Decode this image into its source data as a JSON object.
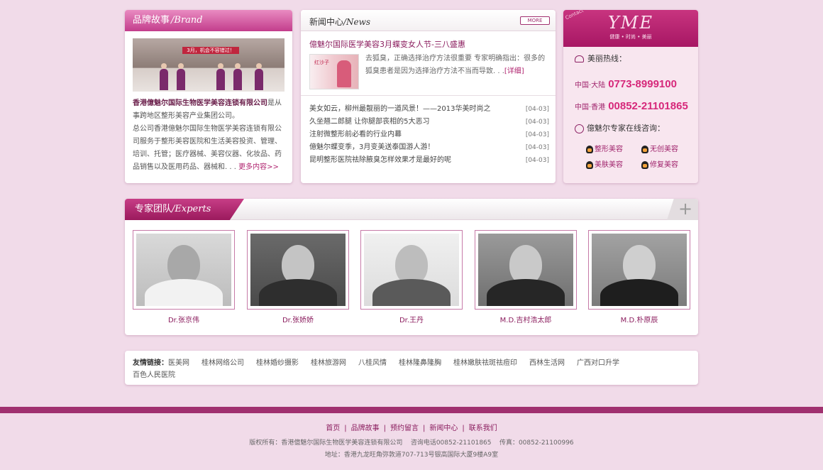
{
  "brand": {
    "title_cn": "品牌故事",
    "title_en": "/Brand",
    "photo_sign": "3月，机会不容错过！",
    "company": "香港億魅尔国际生物医学美容连锁有限公司",
    "text1": "是从事跨地区整形美容产业集团公司。",
    "text2": "总公司香港億魅尔国际生物医学美容连锁有限公司服务于整形美容医院和生活美容投资、管理、培训、托管；医疗器械、美容仪器、化妆品、药品销售以及医用药品、器械和. . .",
    "more": "更多内容>>"
  },
  "news": {
    "title_cn": "新闻中心",
    "title_en": "/News",
    "more": "MORE",
    "top_title": "億魅尔国际医学美容3月蝶变女人节-三八盛惠",
    "thumb_text": "红沙子",
    "summary": "去狐臭，正确选择治疗方法很重要 专家明确指出：很多的狐臭患者是因为选择治疗方法不当而导致. . .",
    "detail": "[详细]",
    "items": [
      {
        "title": "美女如云，柳州最靓丽的一道风景！——2013华美时尚之",
        "date": "[04-03]"
      },
      {
        "title": "久坐翘二郎腿 让你腿部丧相的5大恶习",
        "date": "[04-03]"
      },
      {
        "title": "注射微整形前必看的行业内幕",
        "date": "[04-03]"
      },
      {
        "title": "億魅尔蝶变季，3月变美送泰国游人游！",
        "date": "[04-03]"
      },
      {
        "title": "昆明整形医院祛除腋臭怎样效果才是最好的呢",
        "date": "[04-03]"
      }
    ]
  },
  "contact": {
    "logo_tag": "Contact",
    "logo": "YME",
    "logo_sub": "健康 • 时尚 • 美丽",
    "hotline_label": "美丽热线：",
    "phones": [
      {
        "region": "中国·大陆",
        "number": "0773-8999100"
      },
      {
        "region": "中国·香港",
        "number": "00852-21101865"
      }
    ],
    "consult_label": "億魅尔专家在线咨询：",
    "qq": [
      "整形美容",
      "无创美容",
      "美肤美容",
      "修复美容"
    ]
  },
  "experts": {
    "title_cn": "专家团队",
    "title_en": "/Experts",
    "plus": "+",
    "people": [
      {
        "name": "Dr.张京伟"
      },
      {
        "name": "Dr.张娇娇"
      },
      {
        "name": "Dr.王丹"
      },
      {
        "name": "M.D.吉村浩太郎"
      },
      {
        "name": "M.D.朴原辰"
      }
    ]
  },
  "links": {
    "label": "友情链接：",
    "items": [
      "医美网",
      "桂林网络公司",
      "桂林婚纱摄影",
      "桂林旅游网",
      "八桂风情",
      "桂林隆鼻隆胸",
      "桂林嫩肤祛斑祛痘印",
      "西林生活网",
      "广西对口升学",
      "百色人民医院"
    ]
  },
  "footer": {
    "nav": [
      "首页",
      "品牌故事",
      "预约留言",
      "新闻中心",
      "联系我们"
    ],
    "copyright": "版权所有：香港億魅尔国际生物医学美容连锁有限公司",
    "consult_phone": "咨询电话00852-21101865",
    "fax": "传真：00852-21100996",
    "address": "地址：香港九龙旺角弥敦道707-713号银高国际大厦9楼A9室"
  }
}
